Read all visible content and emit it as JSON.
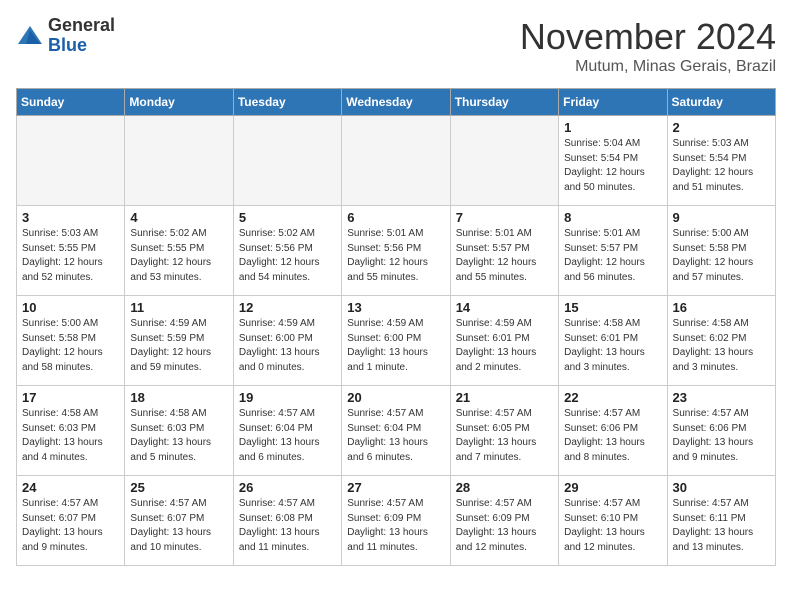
{
  "header": {
    "logo_general": "General",
    "logo_blue": "Blue",
    "month_title": "November 2024",
    "location": "Mutum, Minas Gerais, Brazil"
  },
  "days_of_week": [
    "Sunday",
    "Monday",
    "Tuesday",
    "Wednesday",
    "Thursday",
    "Friday",
    "Saturday"
  ],
  "weeks": [
    [
      {
        "day": "",
        "info": ""
      },
      {
        "day": "",
        "info": ""
      },
      {
        "day": "",
        "info": ""
      },
      {
        "day": "",
        "info": ""
      },
      {
        "day": "",
        "info": ""
      },
      {
        "day": "1",
        "info": "Sunrise: 5:04 AM\nSunset: 5:54 PM\nDaylight: 12 hours and 50 minutes."
      },
      {
        "day": "2",
        "info": "Sunrise: 5:03 AM\nSunset: 5:54 PM\nDaylight: 12 hours and 51 minutes."
      }
    ],
    [
      {
        "day": "3",
        "info": "Sunrise: 5:03 AM\nSunset: 5:55 PM\nDaylight: 12 hours and 52 minutes."
      },
      {
        "day": "4",
        "info": "Sunrise: 5:02 AM\nSunset: 5:55 PM\nDaylight: 12 hours and 53 minutes."
      },
      {
        "day": "5",
        "info": "Sunrise: 5:02 AM\nSunset: 5:56 PM\nDaylight: 12 hours and 54 minutes."
      },
      {
        "day": "6",
        "info": "Sunrise: 5:01 AM\nSunset: 5:56 PM\nDaylight: 12 hours and 55 minutes."
      },
      {
        "day": "7",
        "info": "Sunrise: 5:01 AM\nSunset: 5:57 PM\nDaylight: 12 hours and 55 minutes."
      },
      {
        "day": "8",
        "info": "Sunrise: 5:01 AM\nSunset: 5:57 PM\nDaylight: 12 hours and 56 minutes."
      },
      {
        "day": "9",
        "info": "Sunrise: 5:00 AM\nSunset: 5:58 PM\nDaylight: 12 hours and 57 minutes."
      }
    ],
    [
      {
        "day": "10",
        "info": "Sunrise: 5:00 AM\nSunset: 5:58 PM\nDaylight: 12 hours and 58 minutes."
      },
      {
        "day": "11",
        "info": "Sunrise: 4:59 AM\nSunset: 5:59 PM\nDaylight: 12 hours and 59 minutes."
      },
      {
        "day": "12",
        "info": "Sunrise: 4:59 AM\nSunset: 6:00 PM\nDaylight: 13 hours and 0 minutes."
      },
      {
        "day": "13",
        "info": "Sunrise: 4:59 AM\nSunset: 6:00 PM\nDaylight: 13 hours and 1 minute."
      },
      {
        "day": "14",
        "info": "Sunrise: 4:59 AM\nSunset: 6:01 PM\nDaylight: 13 hours and 2 minutes."
      },
      {
        "day": "15",
        "info": "Sunrise: 4:58 AM\nSunset: 6:01 PM\nDaylight: 13 hours and 3 minutes."
      },
      {
        "day": "16",
        "info": "Sunrise: 4:58 AM\nSunset: 6:02 PM\nDaylight: 13 hours and 3 minutes."
      }
    ],
    [
      {
        "day": "17",
        "info": "Sunrise: 4:58 AM\nSunset: 6:03 PM\nDaylight: 13 hours and 4 minutes."
      },
      {
        "day": "18",
        "info": "Sunrise: 4:58 AM\nSunset: 6:03 PM\nDaylight: 13 hours and 5 minutes."
      },
      {
        "day": "19",
        "info": "Sunrise: 4:57 AM\nSunset: 6:04 PM\nDaylight: 13 hours and 6 minutes."
      },
      {
        "day": "20",
        "info": "Sunrise: 4:57 AM\nSunset: 6:04 PM\nDaylight: 13 hours and 6 minutes."
      },
      {
        "day": "21",
        "info": "Sunrise: 4:57 AM\nSunset: 6:05 PM\nDaylight: 13 hours and 7 minutes."
      },
      {
        "day": "22",
        "info": "Sunrise: 4:57 AM\nSunset: 6:06 PM\nDaylight: 13 hours and 8 minutes."
      },
      {
        "day": "23",
        "info": "Sunrise: 4:57 AM\nSunset: 6:06 PM\nDaylight: 13 hours and 9 minutes."
      }
    ],
    [
      {
        "day": "24",
        "info": "Sunrise: 4:57 AM\nSunset: 6:07 PM\nDaylight: 13 hours and 9 minutes."
      },
      {
        "day": "25",
        "info": "Sunrise: 4:57 AM\nSunset: 6:07 PM\nDaylight: 13 hours and 10 minutes."
      },
      {
        "day": "26",
        "info": "Sunrise: 4:57 AM\nSunset: 6:08 PM\nDaylight: 13 hours and 11 minutes."
      },
      {
        "day": "27",
        "info": "Sunrise: 4:57 AM\nSunset: 6:09 PM\nDaylight: 13 hours and 11 minutes."
      },
      {
        "day": "28",
        "info": "Sunrise: 4:57 AM\nSunset: 6:09 PM\nDaylight: 13 hours and 12 minutes."
      },
      {
        "day": "29",
        "info": "Sunrise: 4:57 AM\nSunset: 6:10 PM\nDaylight: 13 hours and 12 minutes."
      },
      {
        "day": "30",
        "info": "Sunrise: 4:57 AM\nSunset: 6:11 PM\nDaylight: 13 hours and 13 minutes."
      }
    ]
  ]
}
